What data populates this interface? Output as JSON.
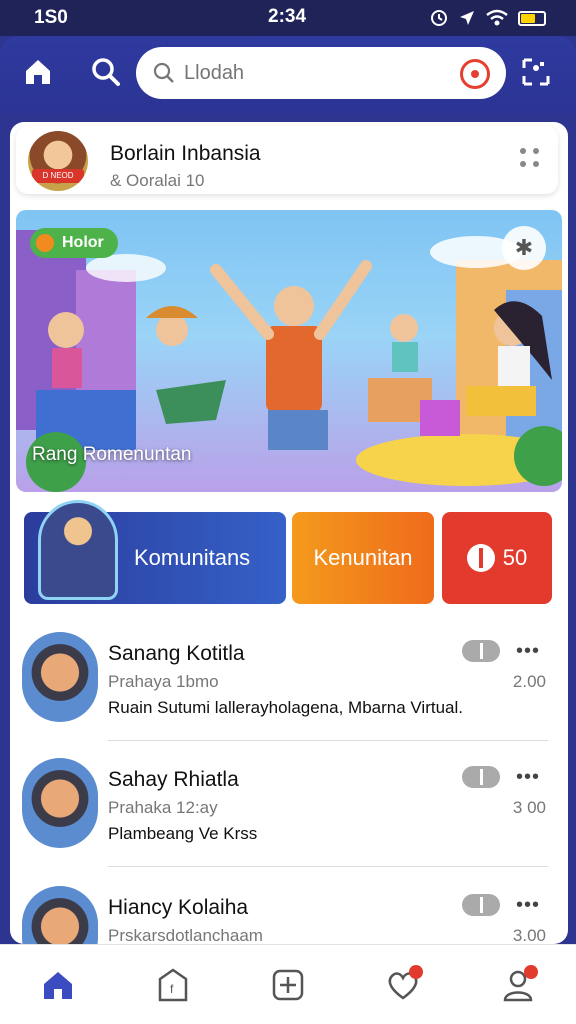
{
  "status_bar": {
    "left": "1S0",
    "time": "2:34"
  },
  "search": {
    "placeholder": "Llodah"
  },
  "profile": {
    "name": "Borlain Inbansia",
    "subtitle": "& Ooralai 10",
    "avatar_tag": "D NEOD"
  },
  "hero": {
    "badge": "Holor",
    "caption": "Rang Romenuntan"
  },
  "categories": [
    {
      "label": "Komunitans"
    },
    {
      "label": "Kenunitan"
    },
    {
      "label": "50"
    }
  ],
  "feed": [
    {
      "name": "Sanang Kotitla",
      "subtitle": "Prahaya 1bmo",
      "text": "Ruain Sutumi lallerayholagena, Mbarna Virtual.",
      "time": "2.00"
    },
    {
      "name": "Sahay Rhiatla",
      "subtitle": "Prahaka 12:ay",
      "text": "Plambeang Ve Krss",
      "time": "3 00"
    },
    {
      "name": "Hiancy Kolaiha",
      "subtitle": "Prskarsdotlanchaam",
      "text": "",
      "time": "3.00"
    }
  ],
  "colors": {
    "header": "#2f3aa0",
    "accent": "#e23a2c",
    "nav_active": "#3b4bc0"
  },
  "icons": [
    "home-icon",
    "search-icon",
    "mic-icon",
    "grid-icon",
    "more-icon",
    "share-icon",
    "tag-icon",
    "plus-icon",
    "heart-icon",
    "user-icon"
  ]
}
